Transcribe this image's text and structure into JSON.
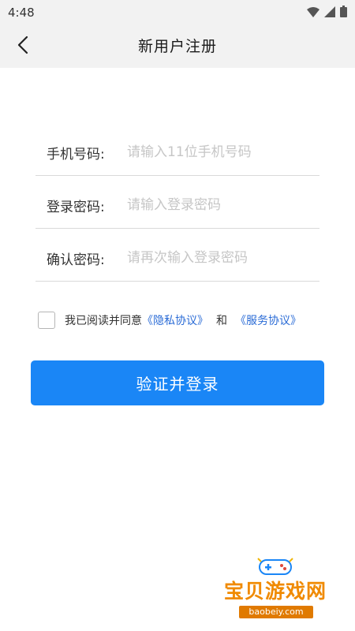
{
  "status_bar": {
    "time": "4:48",
    "icons": [
      "wifi-icon",
      "signal-icon",
      "battery-icon"
    ]
  },
  "header": {
    "title": "新用户注册",
    "back_icon": "chevron-left-icon"
  },
  "form": {
    "fields": [
      {
        "label": "手机号码:",
        "value": "",
        "placeholder": "请输入11位手机号码"
      },
      {
        "label": "登录密码:",
        "value": "",
        "placeholder": "请输入登录密码"
      },
      {
        "label": "确认密码:",
        "value": "",
        "placeholder": "请再次输入登录密码"
      }
    ]
  },
  "agreement": {
    "checked": false,
    "text": "我已阅读并同意",
    "privacy_link": "《隐私协议》",
    "and": "和",
    "service_link": "《服务协议》"
  },
  "submit": {
    "label": "验证并登录"
  },
  "watermark": {
    "brand": "宝贝游戏网",
    "url": "baobeiy.com"
  },
  "colors": {
    "primary": "#1a86f6",
    "link": "#2a6bd6",
    "bar_bg": "#f2f2f2",
    "watermark": "#f08a00"
  }
}
